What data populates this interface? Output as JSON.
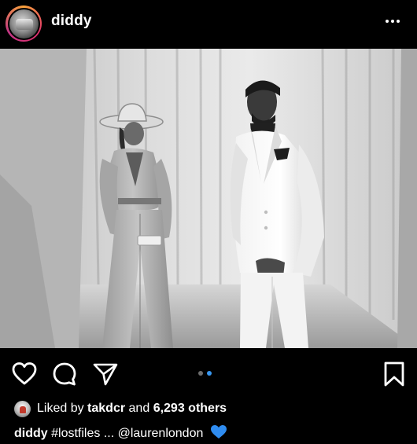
{
  "header": {
    "username": "diddy",
    "avatar_icon": "profile-avatar",
    "more_icon": "more-options-icon"
  },
  "photo": {
    "description_icon": "post-photo",
    "carousel_total": 2,
    "carousel_active": 2
  },
  "actions": {
    "heart_icon": "heart-outline-icon",
    "comment_icon": "comment-bubble-icon",
    "share_icon": "paper-plane-icon",
    "bookmark_icon": "bookmark-outline-icon",
    "active_dot_color": "#3897f0",
    "inactive_dot_color": "#6c6c6c"
  },
  "likes": {
    "prefix": "Liked by",
    "user": "takdcr",
    "connector": "and",
    "others": "6,293 others"
  },
  "caption": {
    "username": "diddy",
    "text": "#lostfiles ... @laurenlondon",
    "emoji": "blue-heart-emoji",
    "emoji_color": "#2f8cf0"
  }
}
